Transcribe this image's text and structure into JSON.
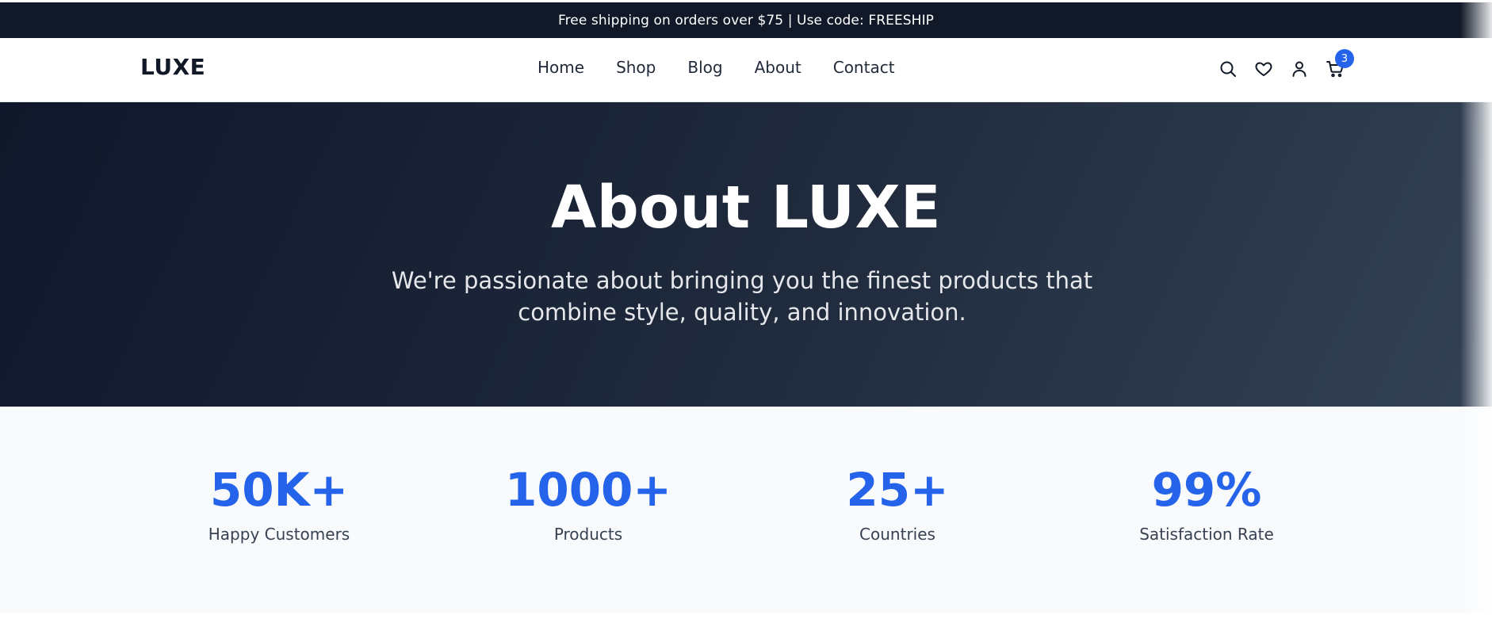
{
  "announcement": {
    "text": "Free shipping on orders over $75 | Use code: FREESHIP"
  },
  "header": {
    "logo": "LUXE",
    "nav": [
      {
        "label": "Home"
      },
      {
        "label": "Shop"
      },
      {
        "label": "Blog"
      },
      {
        "label": "About"
      },
      {
        "label": "Contact"
      }
    ],
    "icons": [
      "search-icon",
      "heart-icon",
      "user-icon",
      "cart-icon"
    ],
    "cart_count": "3"
  },
  "hero": {
    "title": "About LUXE",
    "subtitle": "We're passionate about bringing you the finest products that combine style, quality, and innovation."
  },
  "stats": [
    {
      "value": "50K+",
      "label": "Happy Customers"
    },
    {
      "value": "1000+",
      "label": "Products"
    },
    {
      "value": "25+",
      "label": "Countries"
    },
    {
      "value": "99%",
      "label": "Satisfaction Rate"
    }
  ],
  "colors": {
    "announcement_bg": "#111827",
    "accent": "#2563eb",
    "hero_gradient_start": "#0f172a",
    "hero_gradient_end": "#334155",
    "stats_bg": "#f8fafc"
  }
}
